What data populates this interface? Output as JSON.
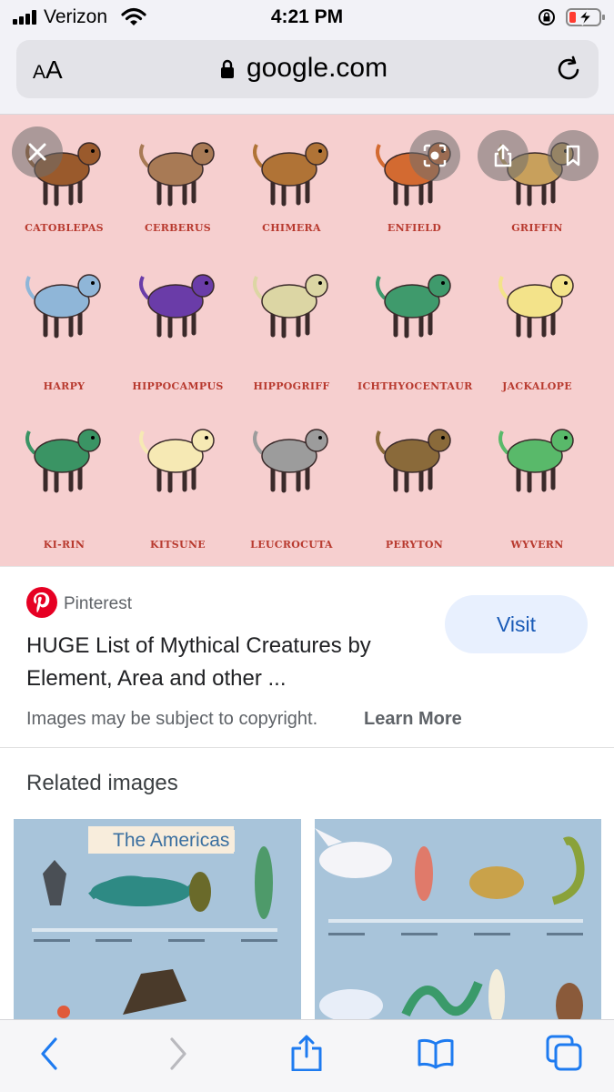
{
  "status_bar": {
    "carrier": "Verizon",
    "time": "4:21 PM"
  },
  "address_bar": {
    "text_size_button": "AA",
    "domain": "google.com"
  },
  "image_viewer": {
    "creatures": [
      {
        "name": "CATOBLEPAS",
        "color": "#9a5a2c"
      },
      {
        "name": "CERBERUS",
        "color": "#a87a55"
      },
      {
        "name": "CHIMERA",
        "color": "#b07336"
      },
      {
        "name": "ENFIELD",
        "color": "#d36a31"
      },
      {
        "name": "GRIFFIN",
        "color": "#c8a05c"
      },
      {
        "name": "HARPY",
        "color": "#8fb6d8"
      },
      {
        "name": "HIPPOCAMPUS",
        "color": "#6a3ca8"
      },
      {
        "name": "HIPPOGRIFF",
        "color": "#dcd6a4"
      },
      {
        "name": "ICHTHYOCENTAUR",
        "color": "#3f9a6c"
      },
      {
        "name": "JACKALOPE",
        "color": "#f3e38a"
      },
      {
        "name": "KI-RIN",
        "color": "#3a9464"
      },
      {
        "name": "KITSUNE",
        "color": "#f6e9b4"
      },
      {
        "name": "LEUCROCUTA",
        "color": "#9c9c9c"
      },
      {
        "name": "PERYTON",
        "color": "#8a6a3a"
      },
      {
        "name": "WYVERN",
        "color": "#59b96a"
      }
    ]
  },
  "result": {
    "source": "Pinterest",
    "title": "HUGE List of Mythical Creatures by Element, Area and other ...",
    "visit_label": "Visit",
    "copyright": "Images may be subject to copyright.",
    "learn_more": "Learn More"
  },
  "related": {
    "heading": "Related images",
    "items": [
      {
        "banner": "The Americas"
      },
      {
        "banner": ""
      }
    ]
  },
  "colors": {
    "image_background": "#f6cfcf",
    "label_red": "#b83a2f",
    "visit_bg": "#e8f0fe",
    "visit_text": "#1a5bb7",
    "pinterest_red": "#e60023",
    "safari_blue": "#1e7bf0"
  }
}
